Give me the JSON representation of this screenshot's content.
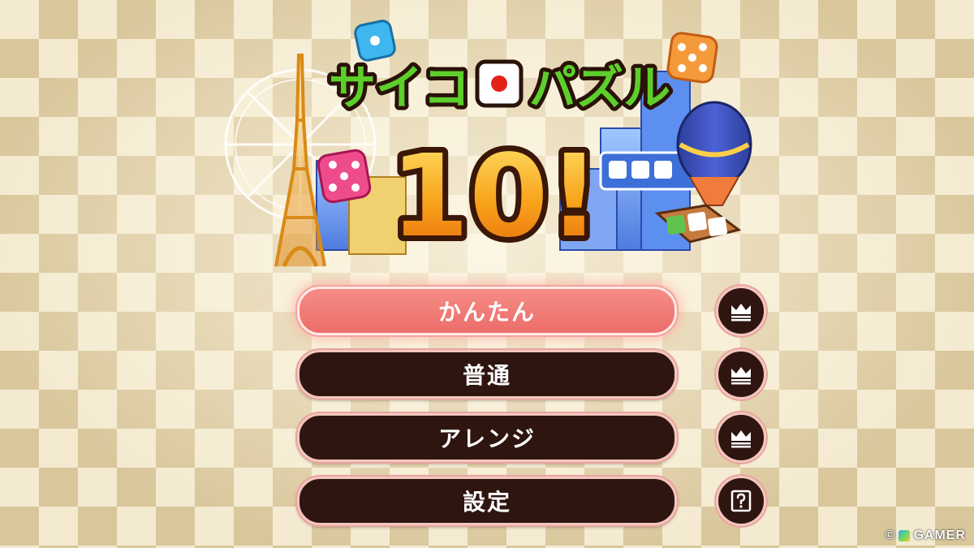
{
  "game": {
    "title_kana_1": "サイコ",
    "title_kana_2": "パズル",
    "title_number": "10!"
  },
  "menu": {
    "items": [
      {
        "label": "かんたん",
        "selected": true,
        "icon": "crown-icon"
      },
      {
        "label": "普通",
        "selected": false,
        "icon": "crown-icon"
      },
      {
        "label": "アレンジ",
        "selected": false,
        "icon": "crown-icon"
      },
      {
        "label": "設定",
        "selected": false,
        "icon": "help-icon"
      }
    ]
  },
  "watermark": {
    "copyright": "©",
    "brand": "GAMER"
  },
  "colors": {
    "button_dark": "#2e1510",
    "button_selected": "#ec6d69",
    "title_green": "#5ccf2b",
    "number_orange": "#f6a318"
  }
}
